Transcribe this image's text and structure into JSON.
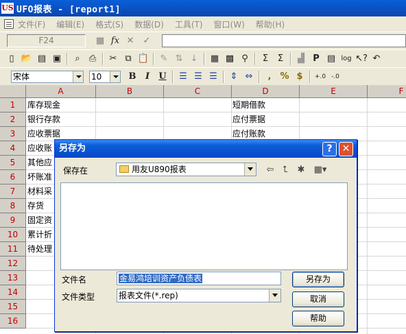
{
  "window": {
    "logo": "US",
    "title": "UFO报表 - [report1]"
  },
  "menu": [
    "文件(F)",
    "编辑(E)",
    "格式(S)",
    "数据(D)",
    "工具(T)",
    "窗口(W)",
    "帮助(H)"
  ],
  "formula_bar": {
    "cell_ref": "F24",
    "fx_label": "fx",
    "value": ""
  },
  "toolbar_format": {
    "font": "宋体",
    "size": "10",
    "bold": "B",
    "italic": "I",
    "underline": "U",
    "comma": ",",
    "percent": "%",
    "currency": "$",
    "dec_inc": "+.0",
    "dec_dec": "-.0"
  },
  "toolbar_main": {
    "sum": "Σ",
    "sum2": "Σ",
    "p": "P",
    "log": "log"
  },
  "sheet": {
    "columns": [
      "A",
      "B",
      "C",
      "D",
      "E",
      "F"
    ],
    "rows": [
      "1",
      "2",
      "3",
      "4",
      "5",
      "6",
      "7",
      "8",
      "9",
      "10",
      "11",
      "12",
      "13",
      "14",
      "15",
      "16"
    ],
    "col_a": [
      "库存现金",
      "银行存款",
      "应收票据",
      "应收账",
      "其他应",
      "坏账准",
      "材料采",
      "存货",
      "固定资",
      "累计折",
      "待处理"
    ],
    "col_d": [
      "短期借款",
      "应付票据",
      "应付账款"
    ]
  },
  "dialog": {
    "title": "另存为",
    "help_btn": "?",
    "close_btn": "✕",
    "save_in_label": "保存在",
    "save_in_value": "用友U890报表",
    "filename_label": "文件名",
    "filename_value": "金易鸿培训资产负债表",
    "filetype_label": "文件类型",
    "filetype_value": "报表文件(*.rep)",
    "save_button": "另存为",
    "cancel_button": "取消",
    "help_button": "帮助"
  }
}
